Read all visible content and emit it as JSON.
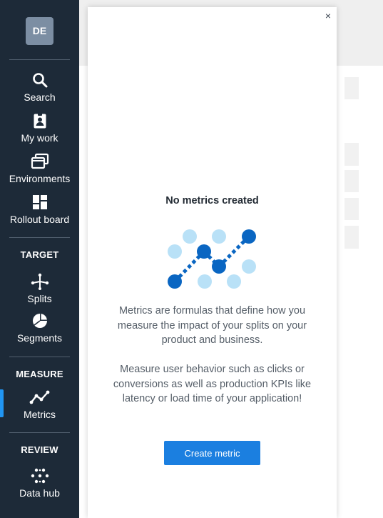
{
  "user": {
    "initials": "DE"
  },
  "nav": {
    "search": "Search",
    "my_work": "My work",
    "environments": "Environments",
    "rollout_board": "Rollout board",
    "target_heading": "TARGET",
    "splits": "Splits",
    "segments": "Segments",
    "measure_heading": "MEASURE",
    "metrics": "Metrics",
    "review_heading": "REVIEW",
    "data_hub": "Data hub"
  },
  "panel": {
    "close_icon": "×",
    "title": "No metrics created",
    "description_1": "Metrics are formulas that define how you measure the impact of your splits on your product and business.",
    "description_2": "Measure user behavior such as clicks or conversions as well as production KPIs like latency or load time of your application!",
    "create_button": "Create metric"
  },
  "colors": {
    "sidebar_bg": "#1d2a38",
    "accent": "#1b7fe0",
    "active_indicator": "#2196f3",
    "dot_dark": "#0a66c2",
    "dot_light": "#b9e1f7"
  },
  "icons": {
    "search": "search-icon",
    "my_work": "badge-icon",
    "environments": "windows-icon",
    "rollout_board": "grid-icon",
    "splits": "split-icon",
    "segments": "pie-icon",
    "metrics": "line-chart-icon",
    "data_hub": "dots-icon",
    "close": "close-icon"
  }
}
